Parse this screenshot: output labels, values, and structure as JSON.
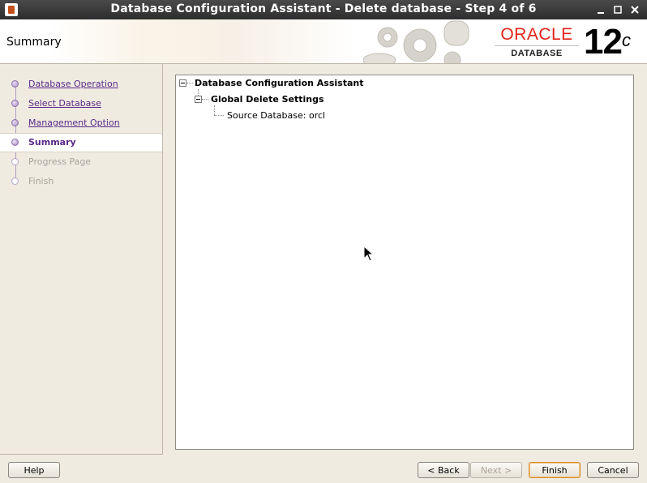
{
  "window": {
    "title": "Database Configuration Assistant - Delete database - Step 4 of 6",
    "controls": [
      "minimize-icon",
      "maximize-icon",
      "close-icon"
    ]
  },
  "header": {
    "page_title": "Summary",
    "logo_word": "ORACLE",
    "logo_sub": "DATABASE",
    "version_main": "12",
    "version_sup": "c"
  },
  "steps": [
    {
      "label": "Database Operation",
      "state": "done"
    },
    {
      "label": "Select Database",
      "state": "done"
    },
    {
      "label": "Management Option",
      "state": "done"
    },
    {
      "label": "Summary",
      "state": "current"
    },
    {
      "label": "Progress Page",
      "state": "future"
    },
    {
      "label": "Finish",
      "state": "future"
    }
  ],
  "summary_tree": {
    "root": "Database Configuration Assistant",
    "group": "Global Delete Settings",
    "item": "Source Database: orcl"
  },
  "buttons": {
    "help": "Help",
    "back": "< Back",
    "next": "Next >",
    "finish": "Finish",
    "cancel": "Cancel"
  },
  "colors": {
    "oracle_red": "#e2231a",
    "step_purple": "#5a2a88",
    "window_bg": "#efebe1"
  }
}
